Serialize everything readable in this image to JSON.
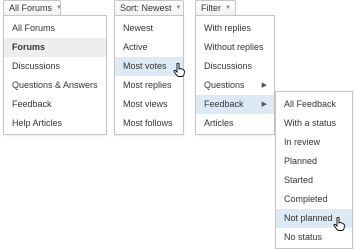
{
  "forums": {
    "button_label": "All Forums",
    "items": [
      {
        "label": "All Forums"
      },
      {
        "label": "Forums"
      },
      {
        "label": "Discussions"
      },
      {
        "label": "Questions & Answers"
      },
      {
        "label": "Feedback"
      },
      {
        "label": "Help Articles"
      }
    ]
  },
  "sort": {
    "button_label": "Sort: Newest",
    "items": [
      {
        "label": "Newest"
      },
      {
        "label": "Active"
      },
      {
        "label": "Most votes"
      },
      {
        "label": "Most replies"
      },
      {
        "label": "Most views"
      },
      {
        "label": "Most follows"
      }
    ]
  },
  "filter": {
    "button_label": "Filter",
    "items": [
      {
        "label": "With replies"
      },
      {
        "label": "Without replies"
      },
      {
        "label": "Discussions"
      },
      {
        "label": "Questions"
      },
      {
        "label": "Feedback"
      },
      {
        "label": "Articles"
      }
    ],
    "submenu": [
      {
        "label": "All Feedback"
      },
      {
        "label": "With a status"
      },
      {
        "label": "In review"
      },
      {
        "label": "Planned"
      },
      {
        "label": "Started"
      },
      {
        "label": "Completed"
      },
      {
        "label": "Not planned"
      },
      {
        "label": "No status"
      }
    ]
  },
  "icons": {
    "caret": "chevron-down-icon",
    "submenu_arrow": "chevron-right-icon",
    "cursor": "hand-pointer-icon"
  },
  "colors": {
    "selected_bg": "#eeeeee",
    "hover_bg": "#dde9f4",
    "border": "#c6c6c6"
  }
}
